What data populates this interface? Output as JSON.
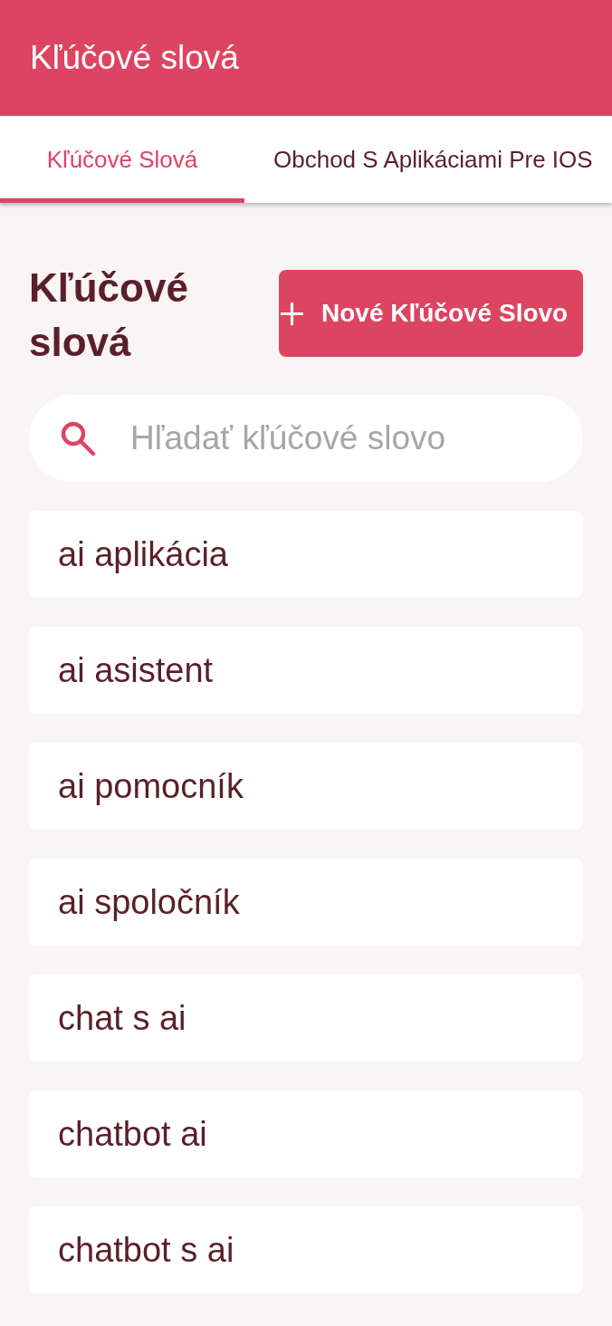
{
  "app_bar": {
    "title": "Kľúčové slová"
  },
  "tabs": [
    {
      "label": "Kľúčové Slová",
      "selected": true
    },
    {
      "label": "Obchod S Aplikáciami Pre IOS",
      "selected": false
    }
  ],
  "page": {
    "heading": "Kľúčové slová",
    "new_button": {
      "label": "Nové Kľúčové Slovo"
    }
  },
  "search": {
    "placeholder": "Hľadať kľúčové slovo"
  },
  "keywords": [
    "ai aplikácia",
    "ai asistent",
    "ai pomocník",
    "ai spoločník",
    "chat s ai",
    "chatbot ai",
    "chatbot s ai"
  ]
}
